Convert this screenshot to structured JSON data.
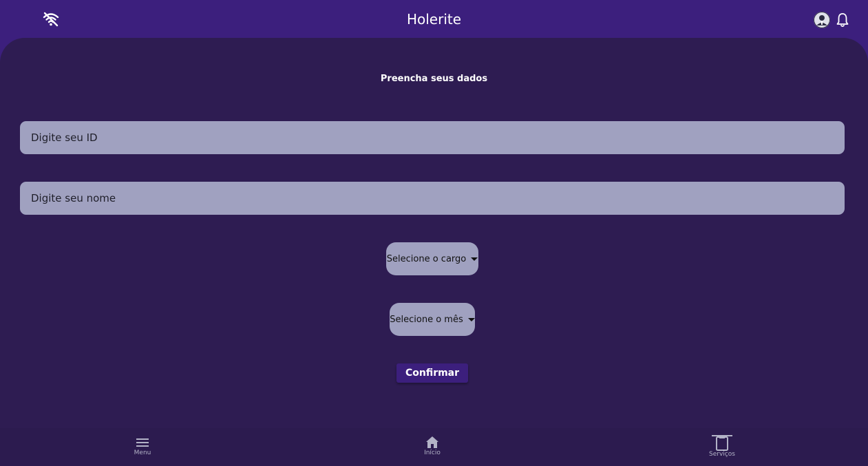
{
  "header": {
    "title": "Holerite",
    "left_icon": "wifi-off-icon",
    "right_icons": [
      "avatar",
      "bell-icon"
    ]
  },
  "form": {
    "title": "Preencha seus dados",
    "id_placeholder": "Digite seu ID",
    "name_placeholder": "Digite seu nome",
    "cargo_label": "Selecione o cargo",
    "mes_label": "Selecione o mês",
    "confirm_label": "Confirmar"
  },
  "nav": {
    "items": [
      {
        "label": "Menu",
        "icon": "hamburger-menu-icon"
      },
      {
        "label": "Início",
        "icon": "home-icon"
      },
      {
        "label": "Serviços",
        "icon": "clipboard-icon"
      }
    ]
  },
  "colors": {
    "header_bg": "#3c1f7d",
    "panel_bg": "#2e1c52",
    "field_bg": "#a0a1c0",
    "button_bg": "#3c1f7d"
  }
}
